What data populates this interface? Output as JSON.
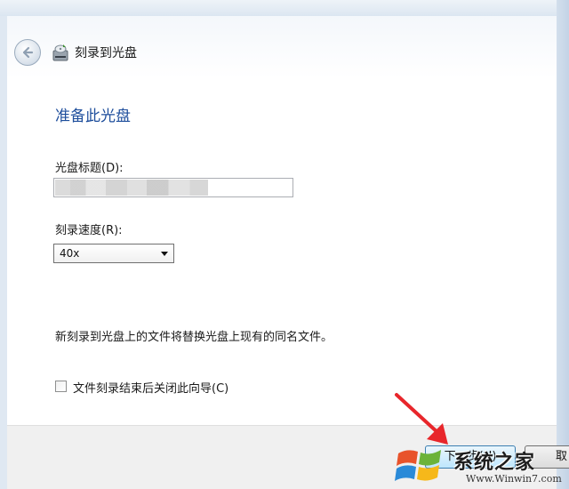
{
  "window": {
    "title": "刻录到光盘"
  },
  "content": {
    "heading": "准备此光盘",
    "disc_title_label": "光盘标题(D):",
    "disc_title_value": "",
    "speed_label": "刻录速度(R):",
    "speed_selected": "40x",
    "info_text": "新刻录到光盘上的文件将替换光盘上现有的同名文件。",
    "close_wizard_label": "文件刻录结束后关闭此向导(C)",
    "close_wizard_checked": false
  },
  "footer": {
    "next_label": "下一步(N)",
    "cancel_label": "取"
  },
  "watermark": {
    "text": "系统之家",
    "url": "Www.Winwin7.com"
  },
  "colors": {
    "heading": "#1e4e9c",
    "annotation_arrow": "#e8262b",
    "next_button_border": "#3c7fb1"
  }
}
